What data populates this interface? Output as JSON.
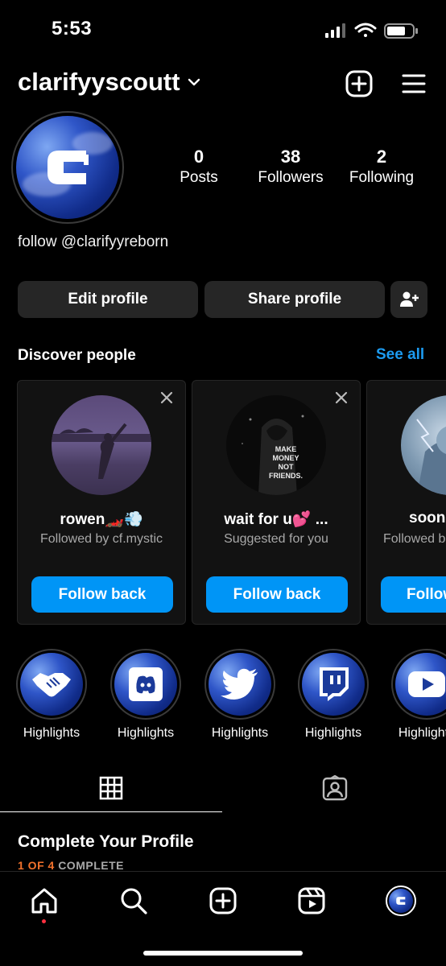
{
  "status_bar": {
    "time": "5:53",
    "icons": [
      "signal-icon",
      "wifi-icon",
      "battery-icon"
    ]
  },
  "header": {
    "username": "clarifyyscoutt",
    "icons": [
      "chevron-down-icon",
      "new-post-icon",
      "menu-icon"
    ]
  },
  "profile": {
    "stats": [
      {
        "value": "0",
        "label": "Posts"
      },
      {
        "value": "38",
        "label": "Followers"
      },
      {
        "value": "2",
        "label": "Following"
      }
    ],
    "bio": "follow @clarifyyreborn"
  },
  "actions": {
    "edit": "Edit profile",
    "share": "Share profile"
  },
  "discover": {
    "title": "Discover people",
    "see_all": "See all",
    "cards": [
      {
        "name": "rowen🏎️💨",
        "sub": "Followed by cf.mystic",
        "button": "Follow back"
      },
      {
        "name": "wait for u💕 ...",
        "sub": "Suggested for you",
        "button": "Follow back",
        "photo_text": "MAKE MONEY NOT FRIENDS."
      },
      {
        "name": "soon",
        "sub": "Followed b",
        "button": "Follow"
      }
    ]
  },
  "highlights": [
    {
      "label": "Highlights",
      "icon": "handshake-icon"
    },
    {
      "label": "Highlights",
      "icon": "discord-icon"
    },
    {
      "label": "Highlights",
      "icon": "twitter-icon"
    },
    {
      "label": "Highlights",
      "icon": "twitch-icon"
    },
    {
      "label": "Highlights",
      "icon": "youtube-icon"
    }
  ],
  "tabs": [
    "grid-icon",
    "tagged-icon"
  ],
  "complete_profile": {
    "title": "Complete Your Profile",
    "count": "1 OF 4",
    "word": "COMPLETE"
  },
  "bottom_nav": [
    "home-icon",
    "search-icon",
    "create-icon",
    "reels-icon",
    "profile-avatar"
  ],
  "colors": {
    "accent": "#0095f6",
    "link": "#1c9bf0",
    "progress": "#f3722c",
    "surface": "#262626"
  }
}
